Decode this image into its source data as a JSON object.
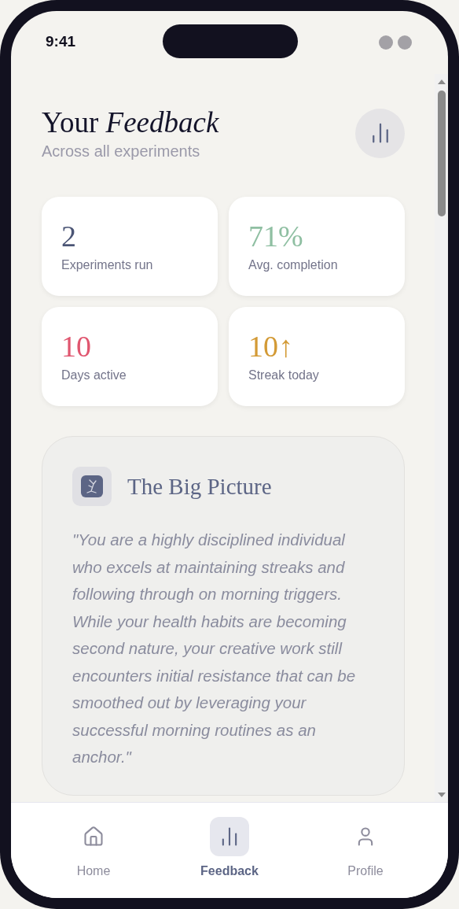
{
  "status_bar": {
    "time": "9:41"
  },
  "header": {
    "title": "Your *Feedback*",
    "subtitle": "Across all experiments"
  },
  "stats": [
    {
      "value": "2",
      "label": "Experiments run",
      "color": "#4b5575"
    },
    {
      "value": "71%",
      "label": "Avg. completion",
      "color": "#8fbfa2"
    },
    {
      "value": "10",
      "label": "Days active",
      "color": "#e0566f"
    },
    {
      "value": "10↑",
      "label": "Streak today",
      "color": "#d39a35"
    }
  ],
  "big_picture": {
    "title": "The Big Picture",
    "quote": "\"You are a highly disciplined individual who excels at maintaining streaks and following through on morning triggers. While your health habits are becoming second nature, your creative work still encounters initial resistance that can be smoothed out by leveraging your successful morning routines as an anchor.\""
  },
  "nav": [
    {
      "label": "Home",
      "kind": "home",
      "selected": false
    },
    {
      "label": "Feedback",
      "kind": "feedback",
      "selected": true
    },
    {
      "label": "Profile",
      "kind": "profile",
      "selected": false
    }
  ]
}
